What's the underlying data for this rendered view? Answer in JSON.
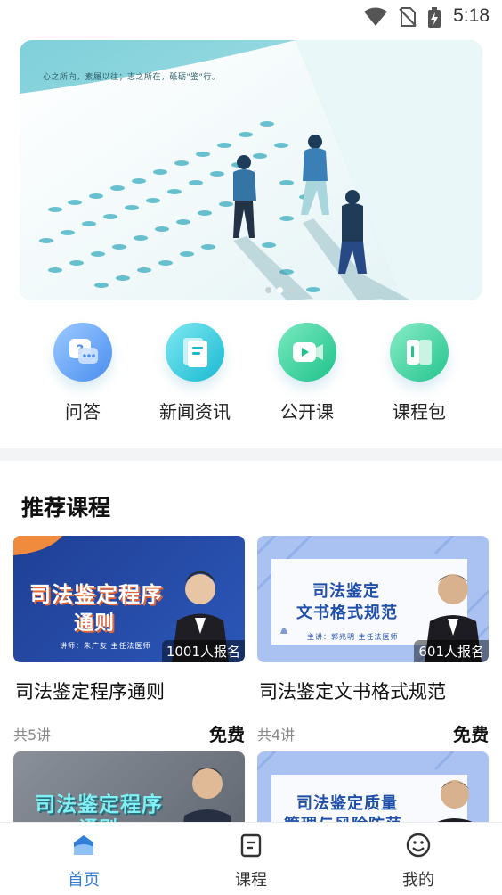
{
  "status_bar": {
    "time": "5:18"
  },
  "banner": {
    "slogan": "心之所向，素履以往；志之所在，砥砺\"鉴\"行。",
    "page_count": 3,
    "active_index": 1
  },
  "quick_links": [
    {
      "label": "问答",
      "icon": "qa-icon",
      "color_from": "#8fc3ff",
      "color_to": "#4a8ef0"
    },
    {
      "label": "新闻资讯",
      "icon": "news-icon",
      "color_from": "#6ee3ec",
      "color_to": "#19b9d2"
    },
    {
      "label": "公开课",
      "icon": "video-icon",
      "color_from": "#6fe6b8",
      "color_to": "#1ec28b"
    },
    {
      "label": "课程包",
      "icon": "package-icon",
      "color_from": "#7ee8c0",
      "color_to": "#25c48f"
    }
  ],
  "section": {
    "title": "推荐课程"
  },
  "courses": [
    {
      "title": "司法鉴定程序通则",
      "thumb_title_line1": "司法鉴定程序",
      "thumb_title_line2": "通则",
      "lecturer": "讲师：朱广友 主任法医师",
      "enrolled": "1001人报名",
      "lectures": "共5讲",
      "price": "免费"
    },
    {
      "title": "司法鉴定文书格式规范",
      "thumb_title_line1": "司法鉴定",
      "thumb_title_line2": "文书格式规范",
      "lecturer": "主讲：郭兆明 主任法医师",
      "enrolled": "601人报名",
      "lectures": "共4讲",
      "price": "免费"
    },
    {
      "title": "",
      "thumb_title_line1": "司法鉴定程序",
      "thumb_title_line2": "通则",
      "lecturer": "",
      "enrolled": "",
      "lectures": "",
      "price": ""
    },
    {
      "title": "",
      "thumb_title_line1": "司法鉴定质量",
      "thumb_title_line2": "管理与风险防范",
      "lecturer": "",
      "enrolled": "",
      "lectures": "",
      "price": ""
    }
  ],
  "tabs": [
    {
      "label": "首页",
      "icon": "home-icon",
      "active": true
    },
    {
      "label": "课程",
      "icon": "course-icon",
      "active": false
    },
    {
      "label": "我的",
      "icon": "profile-icon",
      "active": false
    }
  ],
  "colors": {
    "accent": "#2f7fd6",
    "price": "#111111",
    "muted": "#888888"
  }
}
